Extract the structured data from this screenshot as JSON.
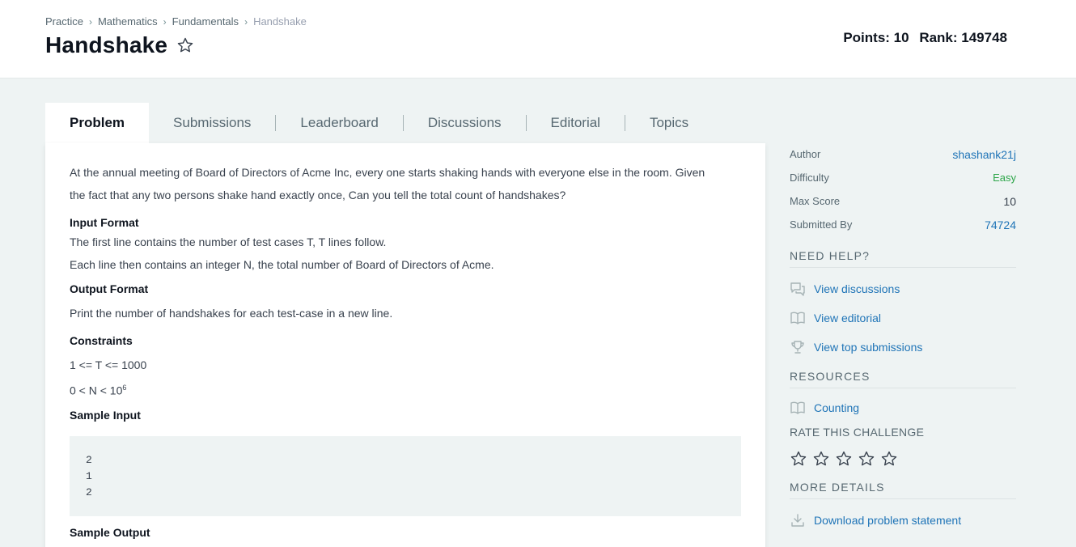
{
  "breadcrumb": {
    "items": [
      "Practice",
      "Mathematics",
      "Fundamentals"
    ],
    "current": "Handshake"
  },
  "page": {
    "title": "Handshake",
    "points": "Points: 10",
    "rank": "Rank: 149748"
  },
  "tabs": [
    "Problem",
    "Submissions",
    "Leaderboard",
    "Discussions",
    "Editorial",
    "Topics"
  ],
  "problem": {
    "intro_line1": "At the annual meeting of Board of Directors of Acme Inc, every one starts shaking hands with everyone else in the room. Given",
    "intro_line2": "the fact that any two persons shake hand exactly once, Can you tell the total count of handshakes?",
    "input_heading": "Input Format",
    "input_line1": "The first line contains the number of test cases T, T lines follow.",
    "input_line2": "Each line then contains an integer N, the total number of Board of Directors of Acme.",
    "output_heading": "Output Format",
    "output_line": "Print the number of handshakes for each test-case in a new line.",
    "constraints_heading": "Constraints",
    "constraint1": "1 <= T <= 1000",
    "constraint2_base": "0 < N < 10",
    "constraint2_exp": "6",
    "sample_input_heading": "Sample Input",
    "sample_input": [
      "2",
      "1",
      "2"
    ],
    "sample_output_heading": "Sample Output"
  },
  "sidebar": {
    "meta": {
      "author_label": "Author",
      "author_value": "shashank21j",
      "difficulty_label": "Difficulty",
      "difficulty_value": "Easy",
      "maxscore_label": "Max Score",
      "maxscore_value": "10",
      "submitted_label": "Submitted By",
      "submitted_value": "74724"
    },
    "help_heading": "NEED HELP?",
    "help_links": [
      "View discussions",
      "View editorial",
      "View top submissions"
    ],
    "resources_heading": "RESOURCES",
    "resource_link": "Counting",
    "rate_heading": "RATE THIS CHALLENGE",
    "more_heading": "MORE DETAILS",
    "download_link": "Download problem statement"
  },
  "colors": {
    "link": "#1f74b7",
    "easy": "#2ea64a",
    "title": "#0e141e"
  }
}
